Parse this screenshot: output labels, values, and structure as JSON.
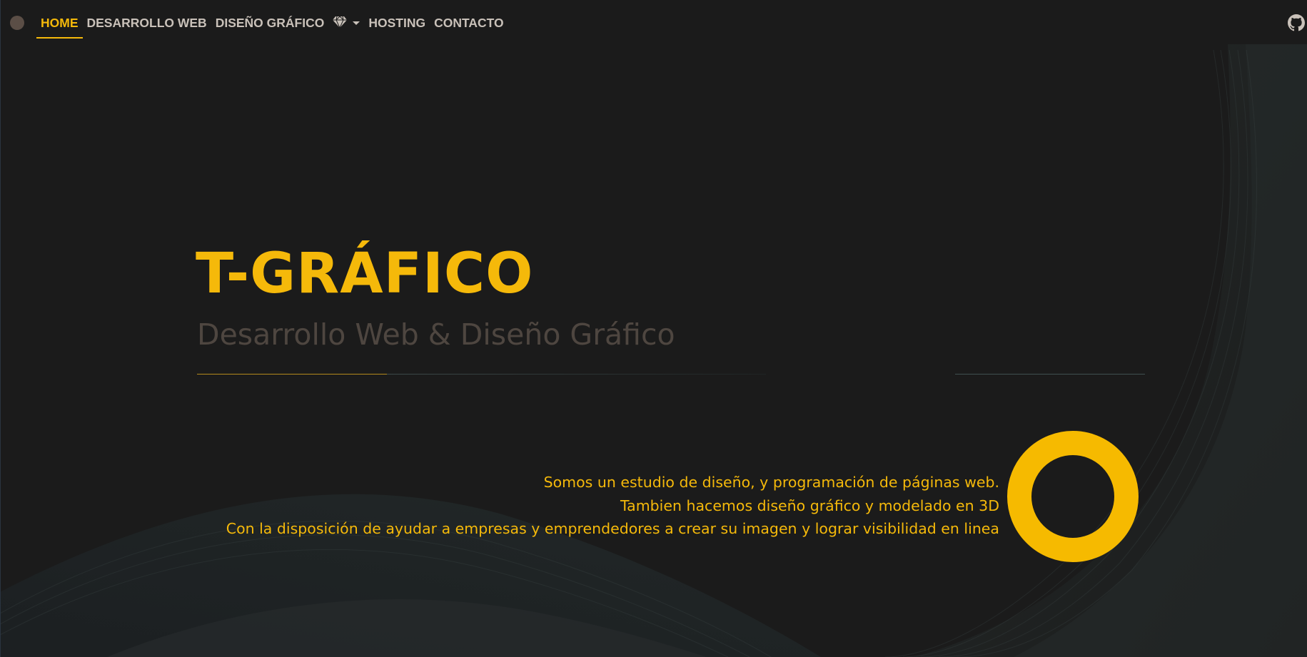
{
  "nav": {
    "brand_icon": "brand-dot-icon",
    "items": [
      {
        "label": "HOME",
        "active": true
      },
      {
        "label": "DESARROLLO WEB",
        "active": false
      },
      {
        "label": "DISEÑO GRÁFICO",
        "active": false
      },
      {
        "label": "",
        "icon": "diamond-icon",
        "dropdown": true,
        "active": false
      },
      {
        "label": "HOSTING",
        "active": false
      },
      {
        "label": "CONTACTO",
        "active": false
      }
    ],
    "right_icon": "github-icon"
  },
  "hero": {
    "title": "T-GRÁFICO",
    "subtitle": "Desarrollo Web & Diseño Gráfico",
    "lines": [
      "Somos un estudio de diseño, y programación de páginas web.",
      "Tambien hacemos diseño gráfico y modelado en 3D",
      "Con la disposición de ayudar a empresas y emprendedores a crear su imagen y lograr visibilidad en linea"
    ],
    "ring_icon": "ring-logo-icon"
  },
  "colors": {
    "background": "#1b1b1b",
    "accent": "#f5b90a",
    "nav_text": "#c9c1b9",
    "subtitle": "#4e4640"
  }
}
